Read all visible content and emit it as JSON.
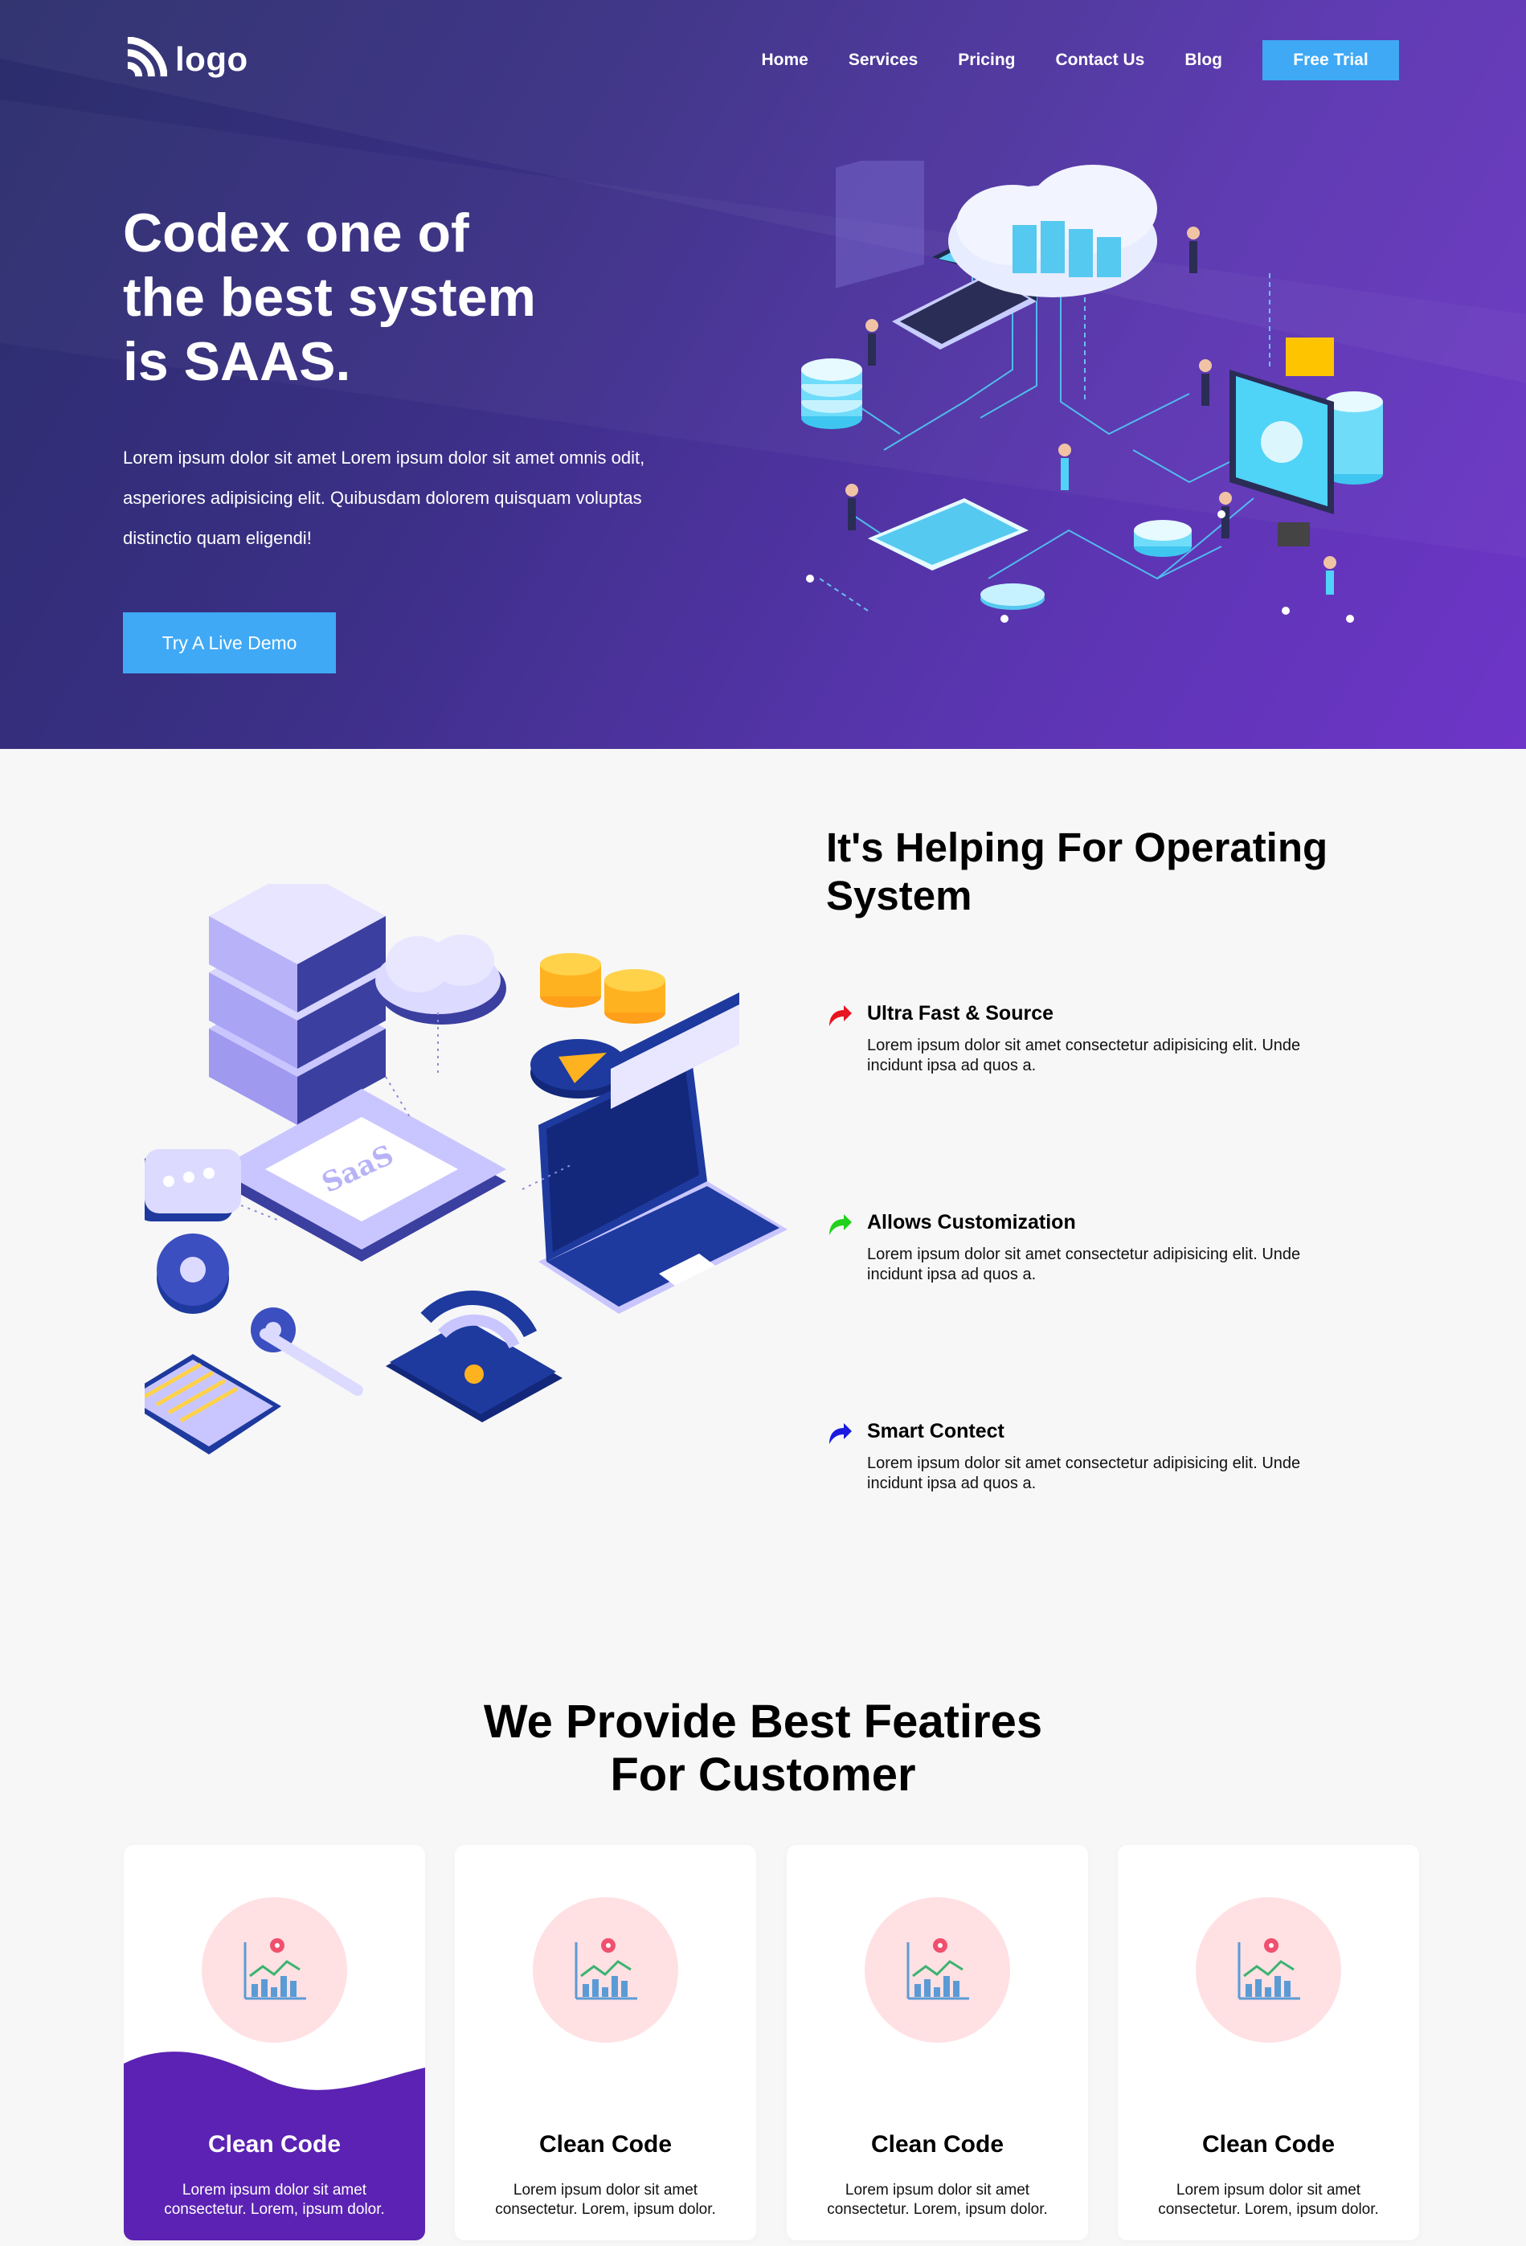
{
  "header": {
    "logo_text": "logo",
    "nav": [
      "Home",
      "Services",
      "Pricing",
      "Contact Us",
      "Blog"
    ],
    "cta": "Free Trial"
  },
  "hero": {
    "title_lines": [
      "Codex one of",
      "the best system",
      "is SAAS."
    ],
    "text": "Lorem ipsum dolor sit amet Lorem ipsum dolor sit amet omnis odit, asperiores adipisicing elit. Quibusdam dolorem quisquam voluptas distinctio quam eligendi!",
    "button": "Try A Live Demo"
  },
  "helping": {
    "title": "It's Helping For Operating System",
    "illustration_label": "SaaS",
    "features": [
      {
        "title": "Ultra Fast & Source",
        "text": "Lorem ipsum dolor sit amet consectetur adipisicing elit. Unde incidunt ipsa ad quos a.",
        "icon": "arrow-icon",
        "color": "#e8141e"
      },
      {
        "title": "Allows Customization",
        "text": "Lorem ipsum dolor sit amet consectetur adipisicing elit. Unde incidunt ipsa ad quos a.",
        "icon": "arrow-icon",
        "color": "#22d11c"
      },
      {
        "title": "Smart Contect",
        "text": "Lorem ipsum dolor sit amet consectetur adipisicing elit. Unde incidunt ipsa ad quos a.",
        "icon": "arrow-icon",
        "color": "#1a1ae0"
      }
    ]
  },
  "features_section": {
    "title_lines": [
      "We Provide Best Featires",
      "For Customer"
    ],
    "cards": [
      {
        "title": "Clean Code",
        "text": "Lorem ipsum dolor sit amet consectetur. Lorem, ipsum dolor.",
        "icon": "chart-pin-icon",
        "active": true
      },
      {
        "title": "Clean Code",
        "text": "Lorem ipsum dolor sit amet consectetur. Lorem, ipsum dolor.",
        "icon": "chart-pin-icon",
        "active": false
      },
      {
        "title": "Clean Code",
        "text": "Lorem ipsum dolor sit amet consectetur. Lorem, ipsum dolor.",
        "icon": "chart-pin-icon",
        "active": false
      },
      {
        "title": "Clean Code",
        "text": "Lorem ipsum dolor sit amet consectetur. Lorem, ipsum dolor.",
        "icon": "chart-pin-icon",
        "active": false
      }
    ]
  },
  "colors": {
    "accent": "#3fa9f5",
    "hero_start": "#2a2d6b",
    "hero_end": "#6e35c8",
    "card_active": "#5b22b3",
    "icon_circle": "#ffe0e3"
  }
}
